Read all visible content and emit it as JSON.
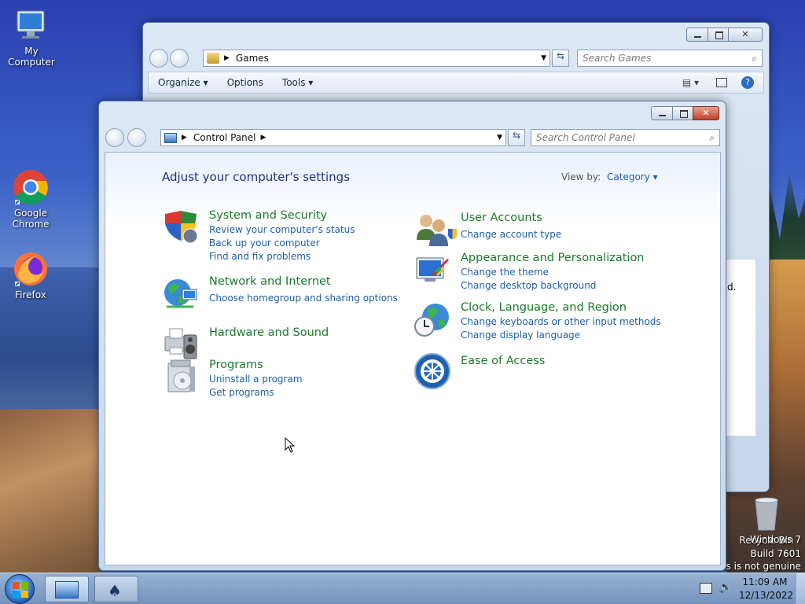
{
  "desktop": {
    "icons": [
      {
        "label": "My Computer"
      },
      {
        "label": "Google Chrome"
      },
      {
        "label": "Firefox"
      },
      {
        "label": "Recycle Bin"
      }
    ],
    "watermark": {
      "line1": "Windows 7",
      "line2": "Build 7601",
      "line3": "ws is not genuine"
    }
  },
  "games_window": {
    "address": "Games",
    "search_placeholder": "Search Games",
    "toolbar": {
      "organize": "Organize",
      "options": "Options",
      "tools": "Tools"
    },
    "partial_text": "d."
  },
  "control_panel": {
    "address": "Control Panel",
    "search_placeholder": "Search Control Panel",
    "heading": "Adjust your computer's settings",
    "view_by_label": "View by:",
    "view_by_value": "Category",
    "categories": [
      {
        "title": "System and Security",
        "icon": "shield-icon",
        "links": [
          "Review your computer's status",
          "Back up your computer",
          "Find and fix problems"
        ]
      },
      {
        "title": "Network and Internet",
        "icon": "network-globe-icon",
        "links": [
          "Choose homegroup and sharing options"
        ]
      },
      {
        "title": "Hardware and Sound",
        "icon": "printer-speaker-icon",
        "links": []
      },
      {
        "title": "Programs",
        "icon": "programs-box-icon",
        "links": [
          "Uninstall a program",
          "Get programs"
        ]
      },
      {
        "title": "User Accounts",
        "icon": "users-icon",
        "links": [
          "Change account type"
        ]
      },
      {
        "title": "Appearance and Personalization",
        "icon": "monitor-brush-icon",
        "links": [
          "Change the theme",
          "Change desktop background"
        ]
      },
      {
        "title": "Clock, Language, and Region",
        "icon": "clock-globe-icon",
        "links": [
          "Change keyboards or other input methods",
          "Change display language"
        ]
      },
      {
        "title": "Ease of Access",
        "icon": "ease-of-access-icon",
        "links": []
      }
    ]
  },
  "taskbar": {
    "time": "11:09 AM",
    "date": "12/13/2022"
  },
  "colors": {
    "link": "#1d5fa8",
    "category_title": "#1a7a2a",
    "heading": "#1e3287"
  }
}
